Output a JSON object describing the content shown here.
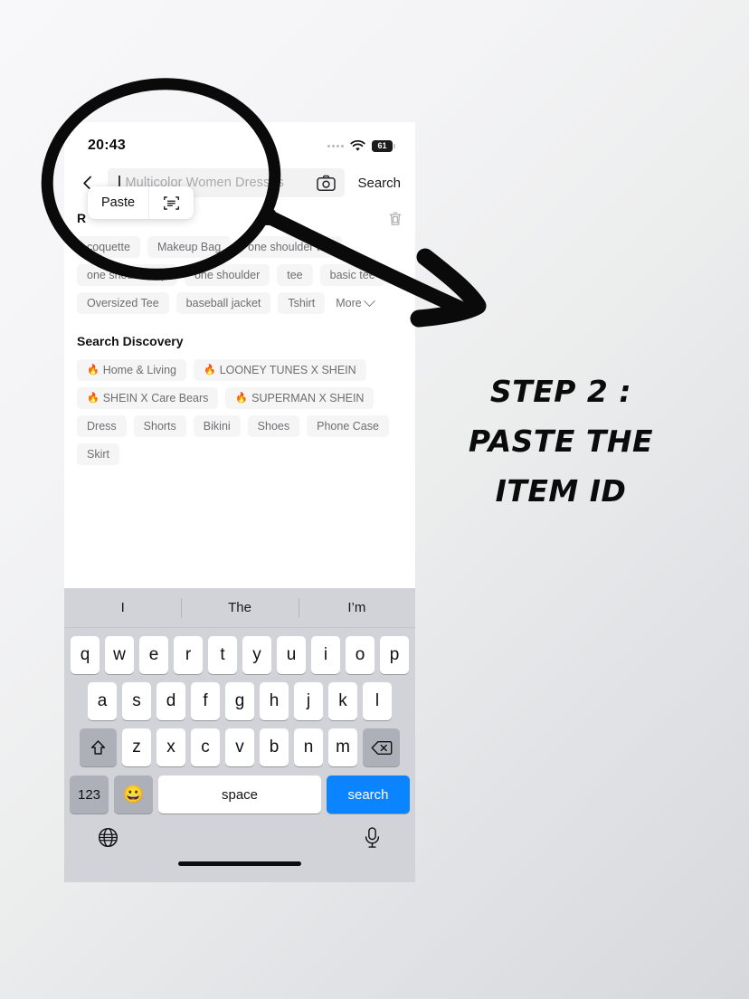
{
  "annotations": {
    "step_text_lines": [
      "STEP 2 :",
      "PASTE THE",
      "ITEM ID"
    ],
    "circle_target": "search-input-paste-area",
    "arrow_label": "arrow-pointing-to-paste"
  },
  "phone": {
    "status_bar": {
      "time": "20:43",
      "signal_icon": "signal-dots-icon",
      "wifi_icon": "wifi-icon",
      "battery_percent": "61",
      "battery_icon": "battery-icon"
    },
    "search_bar": {
      "back_icon": "back-chevron-icon",
      "placeholder": "Multicolor Women Dresses",
      "value": "",
      "camera_icon": "camera-icon",
      "search_button": "Search"
    },
    "paste_popup": {
      "paste_label": "Paste",
      "scan_icon": "scan-text-icon"
    },
    "recent": {
      "label": "R",
      "clear_icon": "trash-icon"
    },
    "recent_chips": [
      {
        "label": "coquette"
      },
      {
        "label": "Makeup Bag"
      },
      {
        "label": "one shoulder top"
      },
      {
        "label": "one shoulder tip"
      },
      {
        "label": "one shoulder"
      },
      {
        "label": "tee"
      },
      {
        "label": "basic tee"
      },
      {
        "label": "Oversized Tee"
      },
      {
        "label": "baseball jacket"
      },
      {
        "label": "Tshirt"
      }
    ],
    "recent_more": {
      "label": "More",
      "icon": "chevron-down-icon"
    },
    "discovery": {
      "title": "Search Discovery",
      "chips": [
        {
          "label": "Home & Living",
          "hot": true
        },
        {
          "label": "LOONEY TUNES X SHEIN",
          "hot": true
        },
        {
          "label": "SHEIN X Care Bears",
          "hot": true
        },
        {
          "label": "SUPERMAN X SHEIN",
          "hot": true
        },
        {
          "label": "Dress",
          "hot": false
        },
        {
          "label": "Shorts",
          "hot": false
        },
        {
          "label": "Bikini",
          "hot": false
        },
        {
          "label": "Shoes",
          "hot": false
        },
        {
          "label": "Phone Case",
          "hot": false
        },
        {
          "label": "Skirt",
          "hot": false
        }
      ]
    },
    "keyboard": {
      "predictions": [
        "I",
        "The",
        "I’m"
      ],
      "row1": [
        "q",
        "w",
        "e",
        "r",
        "t",
        "y",
        "u",
        "i",
        "o",
        "p"
      ],
      "row2": [
        "a",
        "s",
        "d",
        "f",
        "g",
        "h",
        "j",
        "k",
        "l"
      ],
      "row3": [
        "z",
        "x",
        "c",
        "v",
        "b",
        "n",
        "m"
      ],
      "shift_icon": "shift-arrow-icon",
      "backspace_icon": "backspace-icon",
      "numbers_key": "123",
      "emoji_key": "😀",
      "space_key": "space",
      "return_key": "search",
      "globe_icon": "globe-icon",
      "mic_icon": "microphone-icon"
    }
  },
  "colors": {
    "accent": "#0a84ff",
    "hot": "#f5461e",
    "chip_bg": "#f5f5f5",
    "keyboard_bg": "#d1d3d9"
  }
}
